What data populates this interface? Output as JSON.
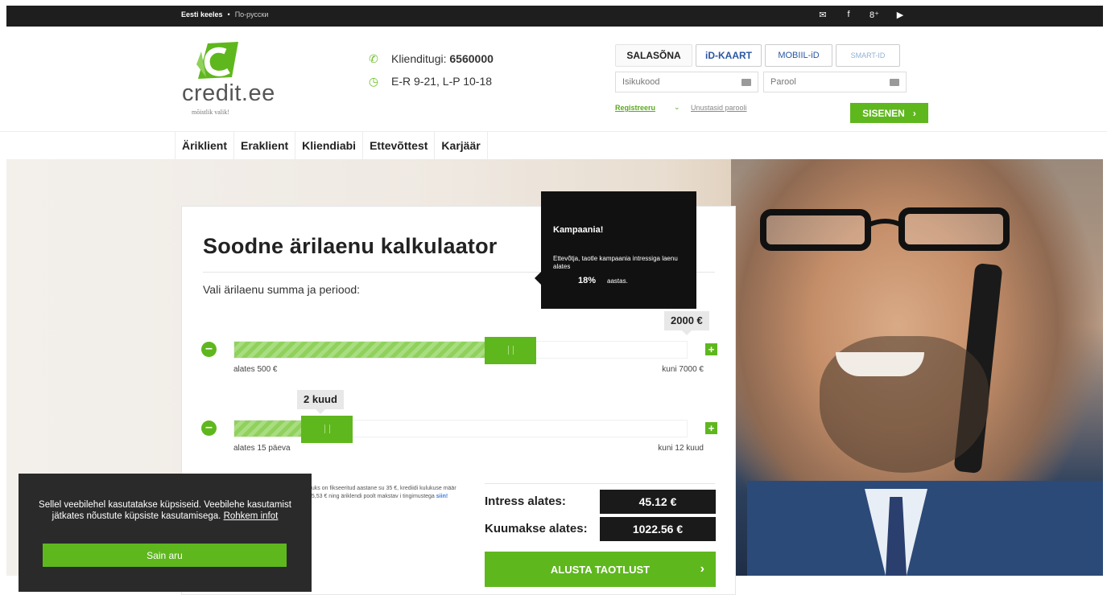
{
  "topbar": {
    "lang_et": "Eesti keeles",
    "lang_ru": "По-русски",
    "social_icons": [
      "mail-icon",
      "facebook-icon",
      "google-plus-icon",
      "youtube-icon"
    ]
  },
  "brand": {
    "name": "credit.ee",
    "tagline": "mõistlik valik!",
    "accent": "#5fb71e"
  },
  "contact": {
    "support_label": "Klienditugi:",
    "support_phone": "6560000",
    "hours": "E-R 9-21, L-P 10-18"
  },
  "login": {
    "tabs": [
      "SALASÕNA",
      "iD-KAART",
      "MOBIIL-iD",
      "SMART-ID"
    ],
    "username_placeholder": "Isikukood",
    "password_placeholder": "Parool",
    "register": "Registreeru",
    "forgot": "Unustasid parooli",
    "submit": "SISENEN"
  },
  "nav": {
    "items": [
      "Äriklient",
      "Eraklient",
      "Kliendiabi",
      "Ettevõttest",
      "Karjäär"
    ],
    "active": "Äriklient"
  },
  "calculator": {
    "title": "Soodne ärilaenu kalkulaator",
    "subtitle": "Vali ärilaenu summa ja periood:",
    "amount": {
      "value_label": "2000 €",
      "min_label": "alates 500  €",
      "max_label": "kuni 7000  €",
      "position": 0.59
    },
    "period": {
      "value_label": "2 kuud",
      "min_label": "alates 15 päeva",
      "max_label": "kuni 12 kuud",
      "position": 0.15
    },
    "fine_print": "uuks on fikseeritud aastane su 35 €, krediidi kulukuse määr 75,53 € ning äriklendi poolt makstav i tingimustega",
    "fine_print_link": "siin!",
    "interest_label": "Intress alates:",
    "interest_value": "45.12 €",
    "monthly_label": "Kuumakse alates:",
    "monthly_value": "1022.56 €",
    "apply": "ALUSTA TAOTLUST"
  },
  "promo": {
    "title": "Kampaania!",
    "text": "Ettevõtja, taotle kampaania intressiga laenu alates",
    "rate": "18%",
    "suffix": "aastas."
  },
  "cookie": {
    "message": "Sellel veebilehel kasutatakse küpsiseid. Veebilehe kasutamist jätkates nõustute küpsiste kasutamisega.",
    "link": "Rohkem infot",
    "button": "Sain aru"
  }
}
